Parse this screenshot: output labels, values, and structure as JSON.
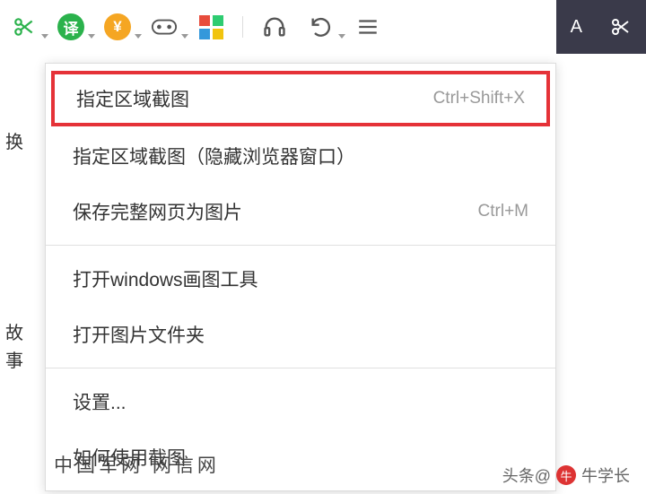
{
  "toolbar": {
    "translate_label": "译"
  },
  "top_right": {
    "letter": "A"
  },
  "menu": {
    "items": [
      {
        "label": "指定区域截图",
        "shortcut": "Ctrl+Shift+X",
        "highlighted": true
      },
      {
        "label": "指定区域截图（隐藏浏览器窗口）",
        "shortcut": ""
      },
      {
        "label": "保存完整网页为图片",
        "shortcut": "Ctrl+M"
      }
    ],
    "items2": [
      {
        "label": "打开windows画图工具",
        "shortcut": ""
      },
      {
        "label": "打开图片文件夹",
        "shortcut": ""
      }
    ],
    "items3": [
      {
        "label": "设置...",
        "shortcut": ""
      },
      {
        "label": "如何使用截图",
        "shortcut": ""
      }
    ]
  },
  "left_strip": {
    "char1": "换",
    "char2": "故",
    "char3": "事"
  },
  "bg_text": "中国军网    网信网",
  "attribution": {
    "prefix": "头条@",
    "name": "牛学长"
  }
}
